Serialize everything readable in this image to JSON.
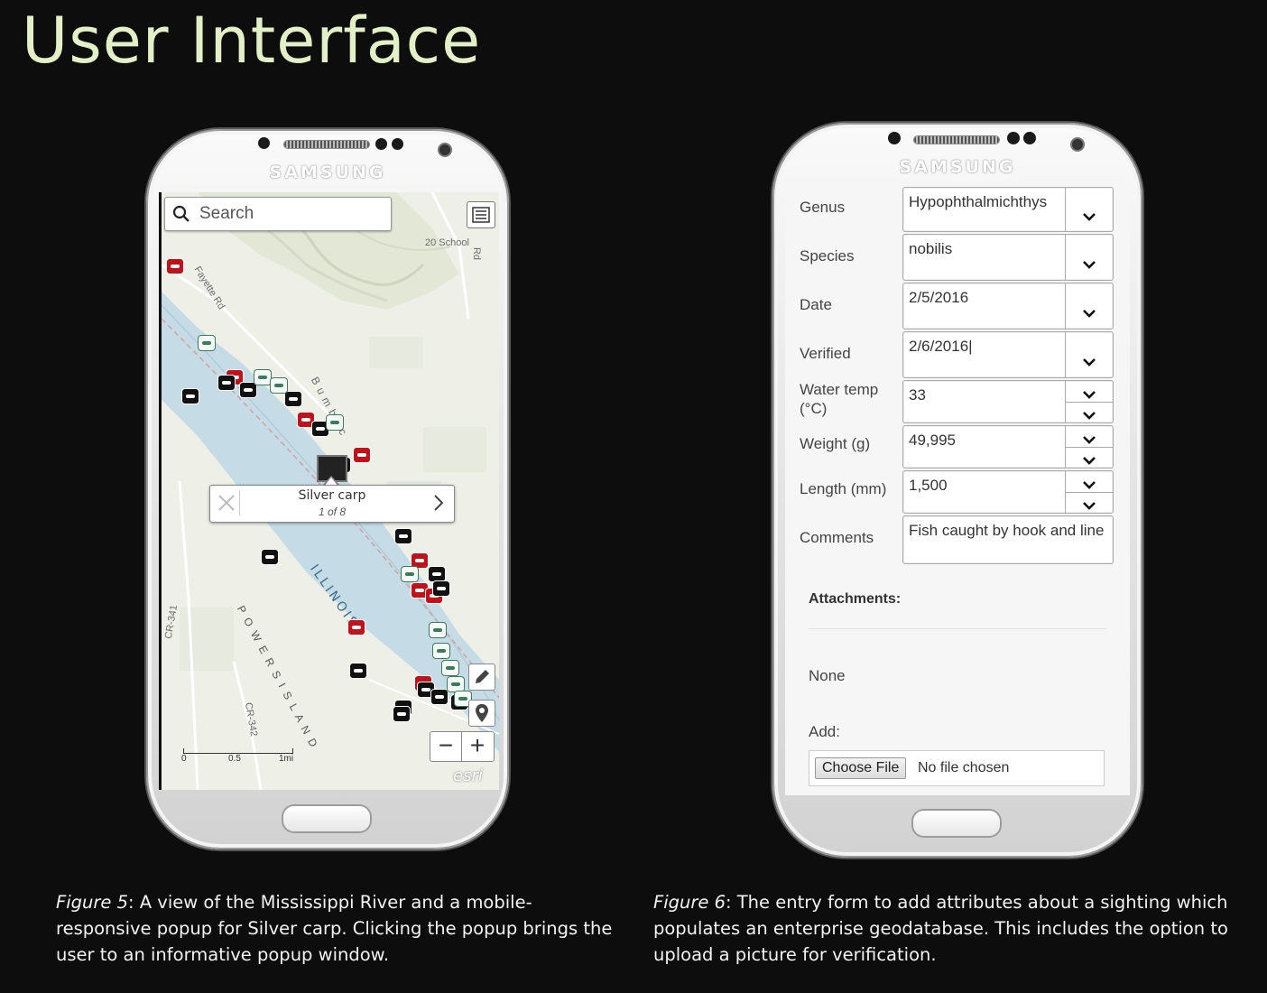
{
  "slide": {
    "title": "User Interface"
  },
  "phones": {
    "brand": "SAMSUNG"
  },
  "map": {
    "search": {
      "placeholder": "Search"
    },
    "labels": {
      "school_rd": "20 School",
      "rd": "Rd",
      "fayette": "Fayette Rd",
      "river": "ILLINOIS",
      "bumback": "B u m b a c",
      "island": "P O W E R S   I S L A N D",
      "cr341": "CR-341",
      "cr342": "CR-342"
    },
    "popup": {
      "title": "Silver carp",
      "count": "1 of 8"
    },
    "scalebar": {
      "ticks": [
        "0",
        "0.5",
        "1mi"
      ]
    },
    "attribution": "esri",
    "markers": {
      "red": [
        [
          5,
          73
        ],
        [
          71,
          196
        ],
        [
          150,
          243
        ],
        [
          212,
          282
        ],
        [
          276,
          399
        ],
        [
          276,
          432
        ],
        [
          292,
          438
        ],
        [
          206,
          473
        ],
        [
          280,
          535
        ]
      ],
      "black": [
        [
          22,
          217
        ],
        [
          62,
          202
        ],
        [
          86,
          210
        ],
        [
          136,
          220
        ],
        [
          166,
          253
        ],
        [
          190,
          293
        ],
        [
          110,
          395
        ],
        [
          258,
          562
        ],
        [
          283,
          542
        ],
        [
          298,
          550
        ],
        [
          320,
          556
        ],
        [
          208,
          521
        ],
        [
          256,
          569
        ],
        [
          295,
          414
        ],
        [
          300,
          430
        ],
        [
          258,
          372
        ]
      ],
      "white": [
        [
          40,
          158
        ],
        [
          102,
          196
        ],
        [
          120,
          205
        ],
        [
          182,
          246
        ],
        [
          265,
          414
        ],
        [
          296,
          476
        ],
        [
          300,
          499
        ],
        [
          310,
          518
        ],
        [
          316,
          536
        ],
        [
          324,
          552
        ]
      ]
    }
  },
  "form": {
    "fields": [
      {
        "label": "Genus",
        "value": "Hypophthalmichthys"
      },
      {
        "label": "Species",
        "value": "nobilis"
      },
      {
        "label": "Date",
        "value": "2/5/2016"
      },
      {
        "label": "Verified",
        "value": "2/6/2016|"
      },
      {
        "label": "Water temp\n(°C)",
        "value": "33"
      },
      {
        "label": "Weight (g)",
        "value": "49,995"
      },
      {
        "label": "Length (mm)",
        "value": "1,500"
      },
      {
        "label": "Comments",
        "value": "Fish caught by hook and line"
      }
    ],
    "attachments": {
      "title": "Attachments:",
      "none": "None",
      "add": "Add:",
      "choose_file": "Choose File",
      "no_file": "No file chosen"
    }
  },
  "captions": [
    {
      "lead": "Figure 5",
      "text": ": A view of the Mississippi River and a mobile-responsive popup for Silver carp. Clicking the popup brings the user to an informative popup window."
    },
    {
      "lead": "Figure 6",
      "text": ": The entry form to add attributes about a sighting which populates an enterprise geodatabase. This includes the option to upload a picture for verification."
    }
  ]
}
